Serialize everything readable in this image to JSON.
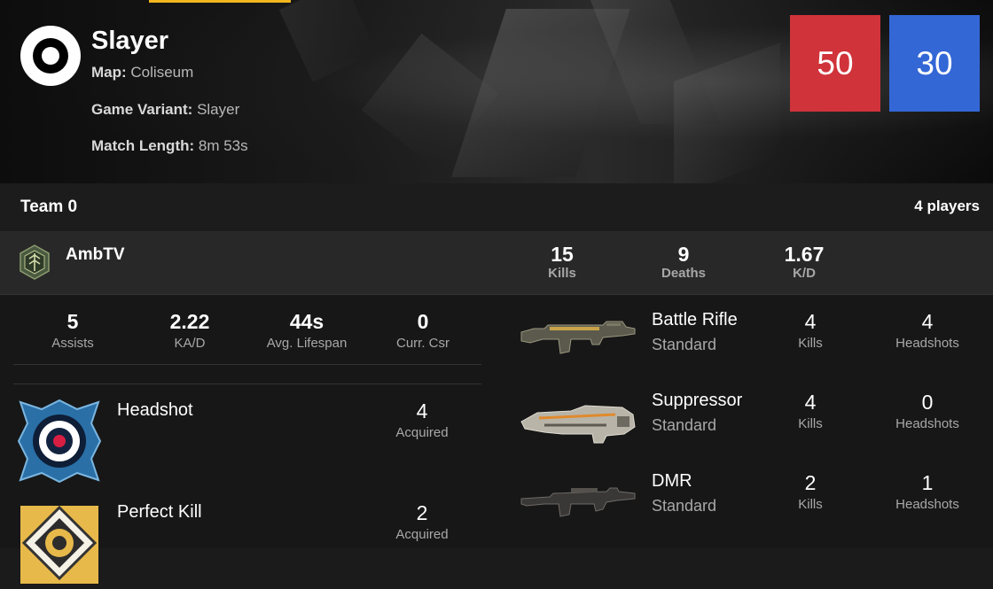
{
  "header": {
    "mode_title": "Slayer",
    "map_label": "Map:",
    "map_value": "Coliseum",
    "variant_label": "Game Variant:",
    "variant_value": "Slayer",
    "length_label": "Match Length:",
    "length_value": "8m 53s",
    "icon": "slayer-target-icon",
    "scores": [
      {
        "value": "50",
        "color": "#d0333a"
      },
      {
        "value": "30",
        "color": "#3367d6"
      }
    ]
  },
  "team": {
    "name": "Team 0",
    "player_count": "4 players"
  },
  "player": {
    "name": "AmbTV",
    "rank_icon": "spartan-rank-icon",
    "kills_value": "15",
    "kills_label": "Kills",
    "deaths_value": "9",
    "deaths_label": "Deaths",
    "kd_value": "1.67",
    "kd_label": "K/D"
  },
  "stats": [
    {
      "value": "5",
      "label": "Assists"
    },
    {
      "value": "2.22",
      "label": "KA/D"
    },
    {
      "value": "44s",
      "label": "Avg. Lifespan"
    },
    {
      "value": "0",
      "label": "Curr. Csr"
    }
  ],
  "medals": [
    {
      "name": "Headshot",
      "count": "4",
      "count_label": "Acquired",
      "icon": "headshot-medal-icon"
    },
    {
      "name": "Perfect Kill",
      "count": "2",
      "count_label": "Acquired",
      "icon": "perfect-kill-medal-icon"
    }
  ],
  "weapons": [
    {
      "name": "Battle Rifle",
      "type": "Standard",
      "kills": "4",
      "kills_label": "Kills",
      "headshots": "4",
      "headshots_label": "Headshots",
      "icon": "battle-rifle-icon"
    },
    {
      "name": "Suppressor",
      "type": "Standard",
      "kills": "4",
      "kills_label": "Kills",
      "headshots": "0",
      "headshots_label": "Headshots",
      "icon": "suppressor-icon"
    },
    {
      "name": "DMR",
      "type": "Standard",
      "kills": "2",
      "kills_label": "Kills",
      "headshots": "1",
      "headshots_label": "Headshots",
      "icon": "dmr-icon"
    }
  ],
  "colors": {
    "accent_bar": "#f3b61f",
    "red_team": "#d0333a",
    "blue_team": "#3367d6"
  }
}
